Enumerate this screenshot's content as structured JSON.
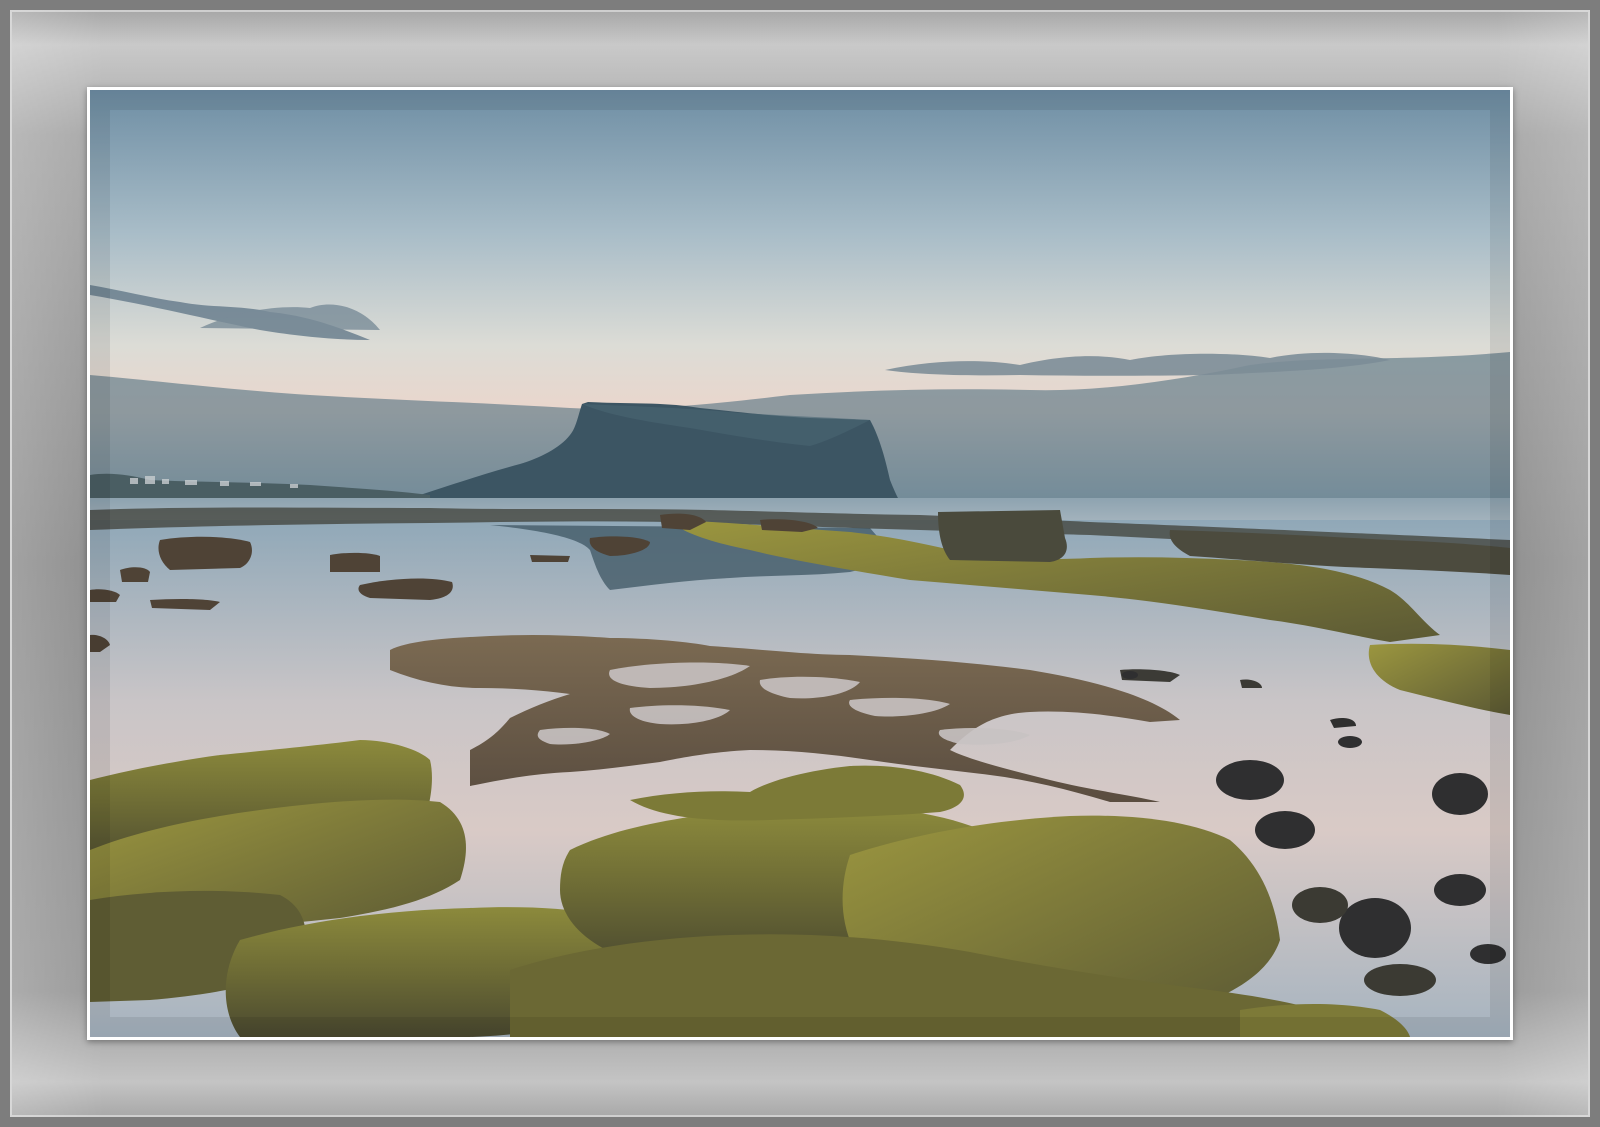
{
  "frame": {
    "name": "gray-photo-mat",
    "colors": {
      "mat": "#8e8e8e",
      "mat_highlight": "#c9c9c9",
      "border": "#ffffff"
    }
  },
  "photo": {
    "subject": "coastal-tidepool-landscape",
    "colors": {
      "sky_top": "#6f8ea3",
      "sky_horizon": "#e9d8cf",
      "cloud": "#5d7587",
      "mountain": "#3e5764",
      "sea": "#b7c3cb",
      "tidepool": "#c6ccd2",
      "moss": "#8a8a3a",
      "rock_dark": "#3b3a33"
    }
  }
}
